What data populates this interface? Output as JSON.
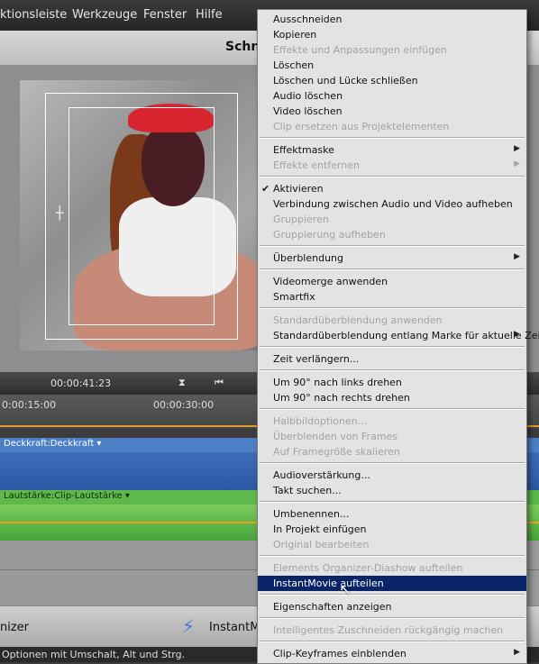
{
  "menubar": {
    "items": [
      "ktionsleiste",
      "Werkzeuge",
      "Fenster",
      "Hilfe"
    ]
  },
  "panel": {
    "title": "Schn"
  },
  "transport": {
    "timecode": "00:00:41:23"
  },
  "timeline": {
    "ruler_ticks": [
      "0:00:15:00",
      "00:00:30:00"
    ],
    "video_track_label": "Deckkraft:Deckkraft",
    "audio_track_label": "Lautstärke:Clip-Lautstärke"
  },
  "bottom": {
    "left_label": "nizer",
    "instantmovie_label": "InstantMo"
  },
  "status": {
    "text": "Optionen mit Umschalt, Alt und Strg."
  },
  "context_menu": {
    "items": [
      {
        "label": "Ausschneiden",
        "enabled": true
      },
      {
        "label": "Kopieren",
        "enabled": true
      },
      {
        "label": "Effekte und Anpassungen einfügen",
        "enabled": false
      },
      {
        "label": "Löschen",
        "enabled": true
      },
      {
        "label": "Löschen und Lücke schließen",
        "enabled": true
      },
      {
        "label": "Audio löschen",
        "enabled": true
      },
      {
        "label": "Video löschen",
        "enabled": true
      },
      {
        "label": "Clip ersetzen aus Projektelementen",
        "enabled": false
      },
      {
        "label": "Effektmaske",
        "enabled": true,
        "submenu": true
      },
      {
        "label": "Effekte entfernen",
        "enabled": false,
        "submenu": true
      },
      {
        "label": "Aktivieren",
        "enabled": true,
        "checked": true
      },
      {
        "label": "Verbindung zwischen Audio und Video aufheben",
        "enabled": true
      },
      {
        "label": "Gruppieren",
        "enabled": false
      },
      {
        "label": "Gruppierung aufheben",
        "enabled": false
      },
      {
        "label": "Überblendung",
        "enabled": true,
        "submenu": true
      },
      {
        "label": "Videomerge anwenden",
        "enabled": true
      },
      {
        "label": "Smartfix",
        "enabled": true
      },
      {
        "label": "Standardüberblendung anwenden",
        "enabled": false
      },
      {
        "label": "Standardüberblendung entlang Marke für aktuelle Zeit",
        "enabled": true,
        "submenu": true
      },
      {
        "label": "Zeit verlängern...",
        "enabled": true
      },
      {
        "label": "Um 90° nach links drehen",
        "enabled": true
      },
      {
        "label": "Um 90° nach rechts drehen",
        "enabled": true
      },
      {
        "label": "Halbbildoptionen...",
        "enabled": false
      },
      {
        "label": "Überblenden von Frames",
        "enabled": false
      },
      {
        "label": "Auf Framegröße skalieren",
        "enabled": false
      },
      {
        "label": "Audioverstärkung...",
        "enabled": true
      },
      {
        "label": "Takt suchen...",
        "enabled": true
      },
      {
        "label": "Umbenennen...",
        "enabled": true
      },
      {
        "label": "In Projekt einfügen",
        "enabled": true
      },
      {
        "label": "Original bearbeiten",
        "enabled": false
      },
      {
        "label": "Elements Organizer-Diashow aufteilen",
        "enabled": false
      },
      {
        "label": "InstantMovie aufteilen",
        "enabled": true,
        "highlighted": true
      },
      {
        "label": "Eigenschaften anzeigen",
        "enabled": true
      },
      {
        "label": "Intelligentes Zuschneiden rückgängig machen",
        "enabled": false
      },
      {
        "label": "Clip-Keyframes einblenden",
        "enabled": true,
        "submenu": true
      }
    ]
  },
  "colors": {
    "menu_highlight": "#0a246a",
    "menu_bg": "#e3e3e3",
    "disabled_text": "#a3a3a3",
    "video_track": "#3f6cb8",
    "audio_track": "#5fb84a",
    "timeline_marker": "#e8962c"
  },
  "icons": [
    "instantmovie-bolt-icon",
    "submenu-arrow-icon",
    "checkmark-icon",
    "mouse-cursor-icon",
    "step-back-icon",
    "marker-icon"
  ]
}
